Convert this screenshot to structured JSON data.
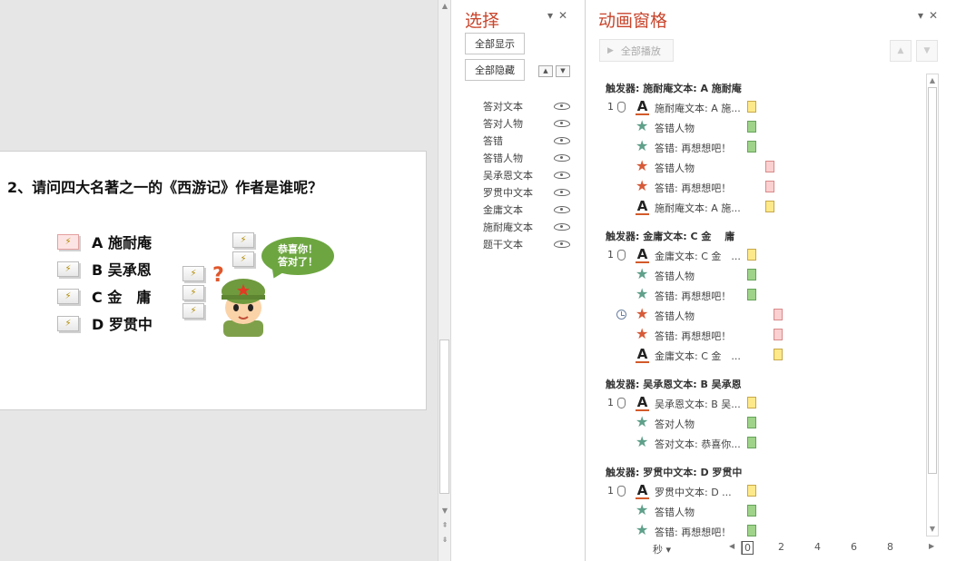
{
  "slide": {
    "question": "2、请问四大名著之一的《西游记》作者是谁呢？",
    "options": [
      {
        "label": "A 施耐庵"
      },
      {
        "label": "B 吴承恩"
      },
      {
        "label": "C 金　庸"
      },
      {
        "label": "D 罗贯中"
      }
    ],
    "bubble_line1": "恭喜你！",
    "bubble_line2": "答对了！",
    "question_mark": "?"
  },
  "selection_pane": {
    "title": "选择",
    "show_all": "全部显示",
    "hide_all": "全部隐藏",
    "items": [
      "答对文本",
      "答对人物",
      "答错",
      "答错人物",
      "吴承恩文本",
      "罗贯中文本",
      "金庸文本",
      "施耐庵文本",
      "题干文本"
    ]
  },
  "animation_pane": {
    "title": "动画窗格",
    "play_all": "全部播放",
    "groups": [
      {
        "trigger": "触发器: 施耐庵文本: A 施耐庵",
        "rows": [
          {
            "num": "1",
            "lead": "mouse",
            "icon": "A",
            "text": "施耐庵文本: A 施...",
            "bar": "yellow",
            "offset": 0
          },
          {
            "num": "",
            "lead": "",
            "icon": "star-green",
            "text": "答错人物",
            "bar": "green",
            "offset": 0
          },
          {
            "num": "",
            "lead": "",
            "icon": "star-green",
            "text": "答错: 再想想吧！",
            "bar": "green",
            "offset": 0
          },
          {
            "num": "",
            "lead": "",
            "icon": "star-red",
            "text": "答错人物",
            "bar": "pink",
            "offset": 20
          },
          {
            "num": "",
            "lead": "",
            "icon": "star-red",
            "text": "答错: 再想想吧！",
            "bar": "pink",
            "offset": 20
          },
          {
            "num": "",
            "lead": "",
            "icon": "A",
            "text": "施耐庵文本: A 施...",
            "bar": "yellow",
            "offset": 20
          }
        ]
      },
      {
        "trigger": "触发器: 金庸文本: C 金　 庸",
        "rows": [
          {
            "num": "1",
            "lead": "mouse",
            "icon": "A",
            "text": "金庸文本: C 金　...",
            "bar": "yellow",
            "offset": 0
          },
          {
            "num": "",
            "lead": "",
            "icon": "star-green",
            "text": "答错人物",
            "bar": "green",
            "offset": 0
          },
          {
            "num": "",
            "lead": "",
            "icon": "star-green",
            "text": "答错: 再想想吧！",
            "bar": "green",
            "offset": 0
          },
          {
            "num": "",
            "lead": "clock",
            "icon": "star-red",
            "text": "答错人物",
            "bar": "pink",
            "offset": 29
          },
          {
            "num": "",
            "lead": "",
            "icon": "star-red",
            "text": "答错: 再想想吧！",
            "bar": "pink",
            "offset": 29
          },
          {
            "num": "",
            "lead": "",
            "icon": "A",
            "text": "金庸文本: C 金　...",
            "bar": "yellow",
            "offset": 29
          }
        ]
      },
      {
        "trigger": "触发器: 吴承恩文本: B 吴承恩",
        "rows": [
          {
            "num": "1",
            "lead": "mouse",
            "icon": "A",
            "text": "吴承恩文本: B 吴...",
            "bar": "yellow",
            "offset": 0
          },
          {
            "num": "",
            "lead": "",
            "icon": "star-green",
            "text": "答对人物",
            "bar": "green",
            "offset": 0
          },
          {
            "num": "",
            "lead": "",
            "icon": "star-green",
            "text": "答对文本: 恭喜你...",
            "bar": "green",
            "offset": 0
          }
        ]
      },
      {
        "trigger": "触发器: 罗贯中文本: D 罗贯中",
        "rows": [
          {
            "num": "1",
            "lead": "mouse",
            "icon": "A",
            "text": "罗贯中文本: D ...",
            "bar": "yellow",
            "offset": 0
          },
          {
            "num": "",
            "lead": "",
            "icon": "star-green",
            "text": "答错人物",
            "bar": "green",
            "offset": 0
          },
          {
            "num": "",
            "lead": "",
            "icon": "star-green",
            "text": "答错: 再想想吧！",
            "bar": "green",
            "offset": 0
          }
        ]
      }
    ],
    "timeline": {
      "unit": "秒",
      "ticks": [
        "0",
        "2",
        "4",
        "6",
        "8"
      ]
    }
  },
  "colors": {
    "pane_title": "#c8452c",
    "bubble": "#6da640",
    "bar_yellow": "#fde98a",
    "bar_green": "#9fd38a",
    "bar_pink": "#fbd0d0"
  }
}
